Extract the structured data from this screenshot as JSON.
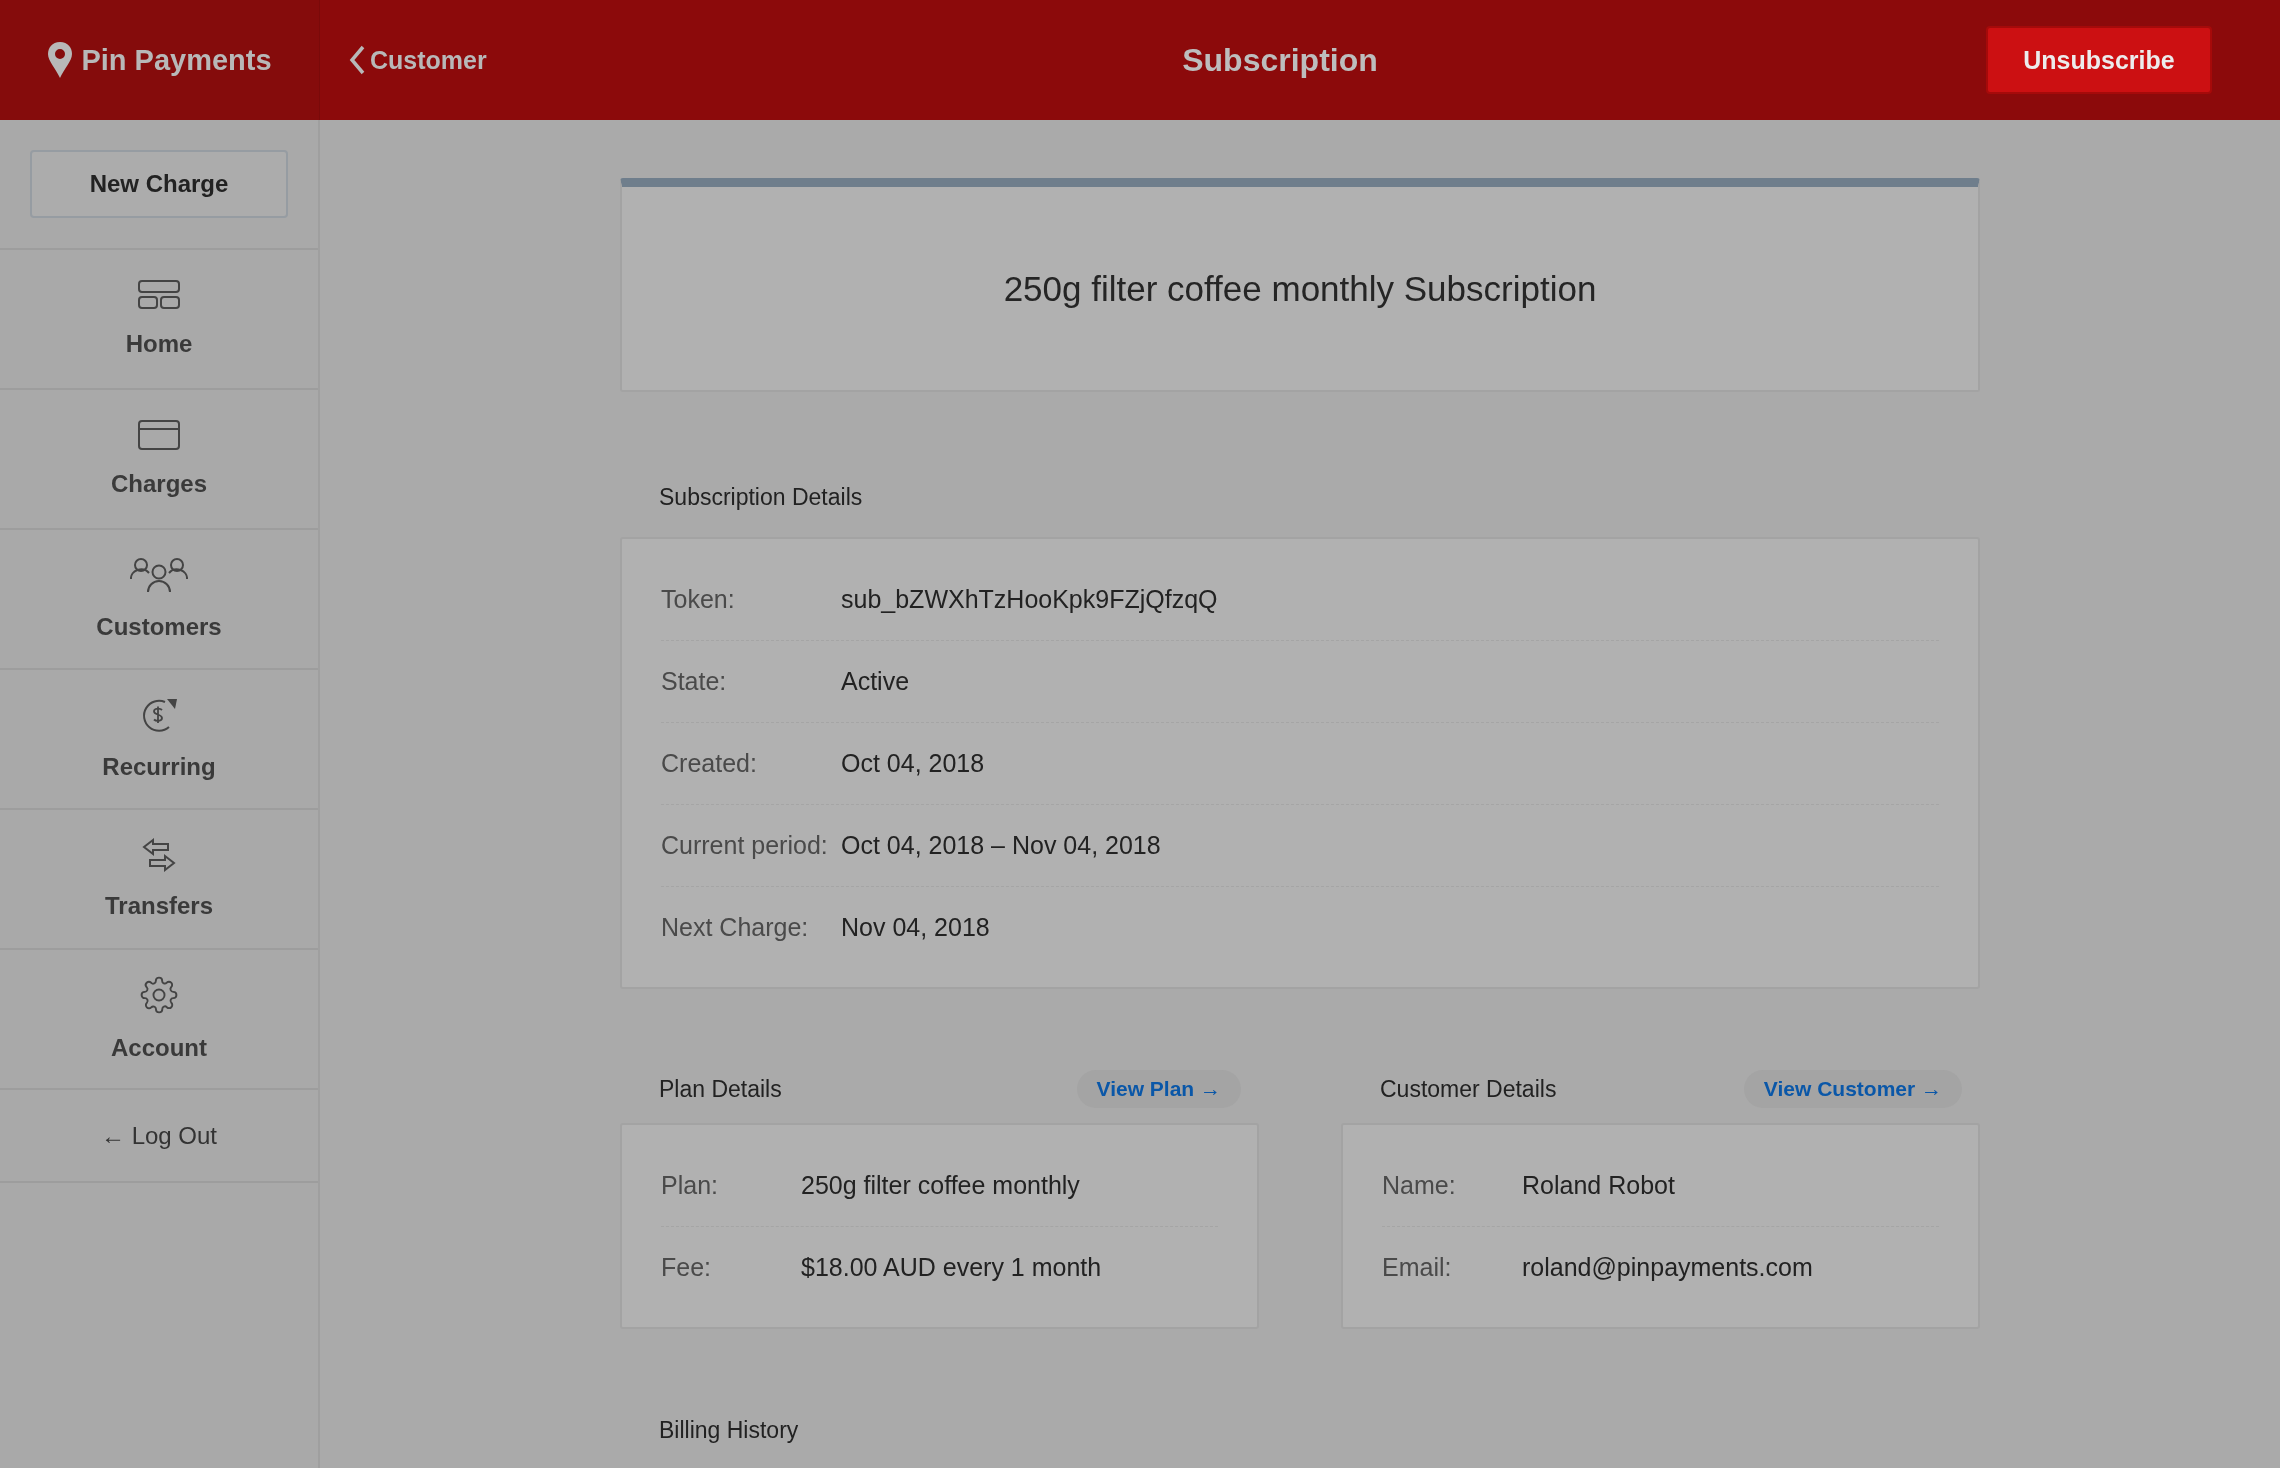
{
  "header": {
    "logo": "Pin Payments",
    "back_link": "Customer",
    "title": "Subscription",
    "action": "Unsubscribe"
  },
  "sidebar": {
    "new_button": "New Charge",
    "items": [
      {
        "label": "Home"
      },
      {
        "label": "Charges"
      },
      {
        "label": "Customers"
      },
      {
        "label": "Recurring"
      },
      {
        "label": "Transfers"
      },
      {
        "label": "Account"
      }
    ],
    "logout": "← Log Out"
  },
  "title_card": {
    "title": "250g filter coffee monthly Subscription"
  },
  "subscription_details": {
    "heading": "Subscription Details",
    "rows": [
      {
        "label": "Token:",
        "value": "sub_bZWXhTzHooKpk9FZjQfzqQ"
      },
      {
        "label": "State:",
        "value": "Active"
      },
      {
        "label": "Created:",
        "value": "Oct 04, 2018"
      },
      {
        "label": "Current period:",
        "value": "Oct 04, 2018 – Nov 04, 2018"
      },
      {
        "label": "Next Charge:",
        "value": "Nov 04, 2018"
      }
    ]
  },
  "panels": [
    {
      "heading": "Plan Details",
      "link": "View Plan →",
      "rows": [
        {
          "label": "Plan:",
          "value": "250g filter coffee monthly"
        },
        {
          "label": "Fee:",
          "value": "$18.00 AUD every 1 month"
        }
      ]
    },
    {
      "heading": "Customer Details",
      "link": "View Customer →",
      "rows": [
        {
          "label": "Name:",
          "value": "Roland Robot"
        },
        {
          "label": "Email:",
          "value": "roland@pinpayments.com"
        }
      ]
    }
  ],
  "billing_history": {
    "heading": "Billing History"
  }
}
